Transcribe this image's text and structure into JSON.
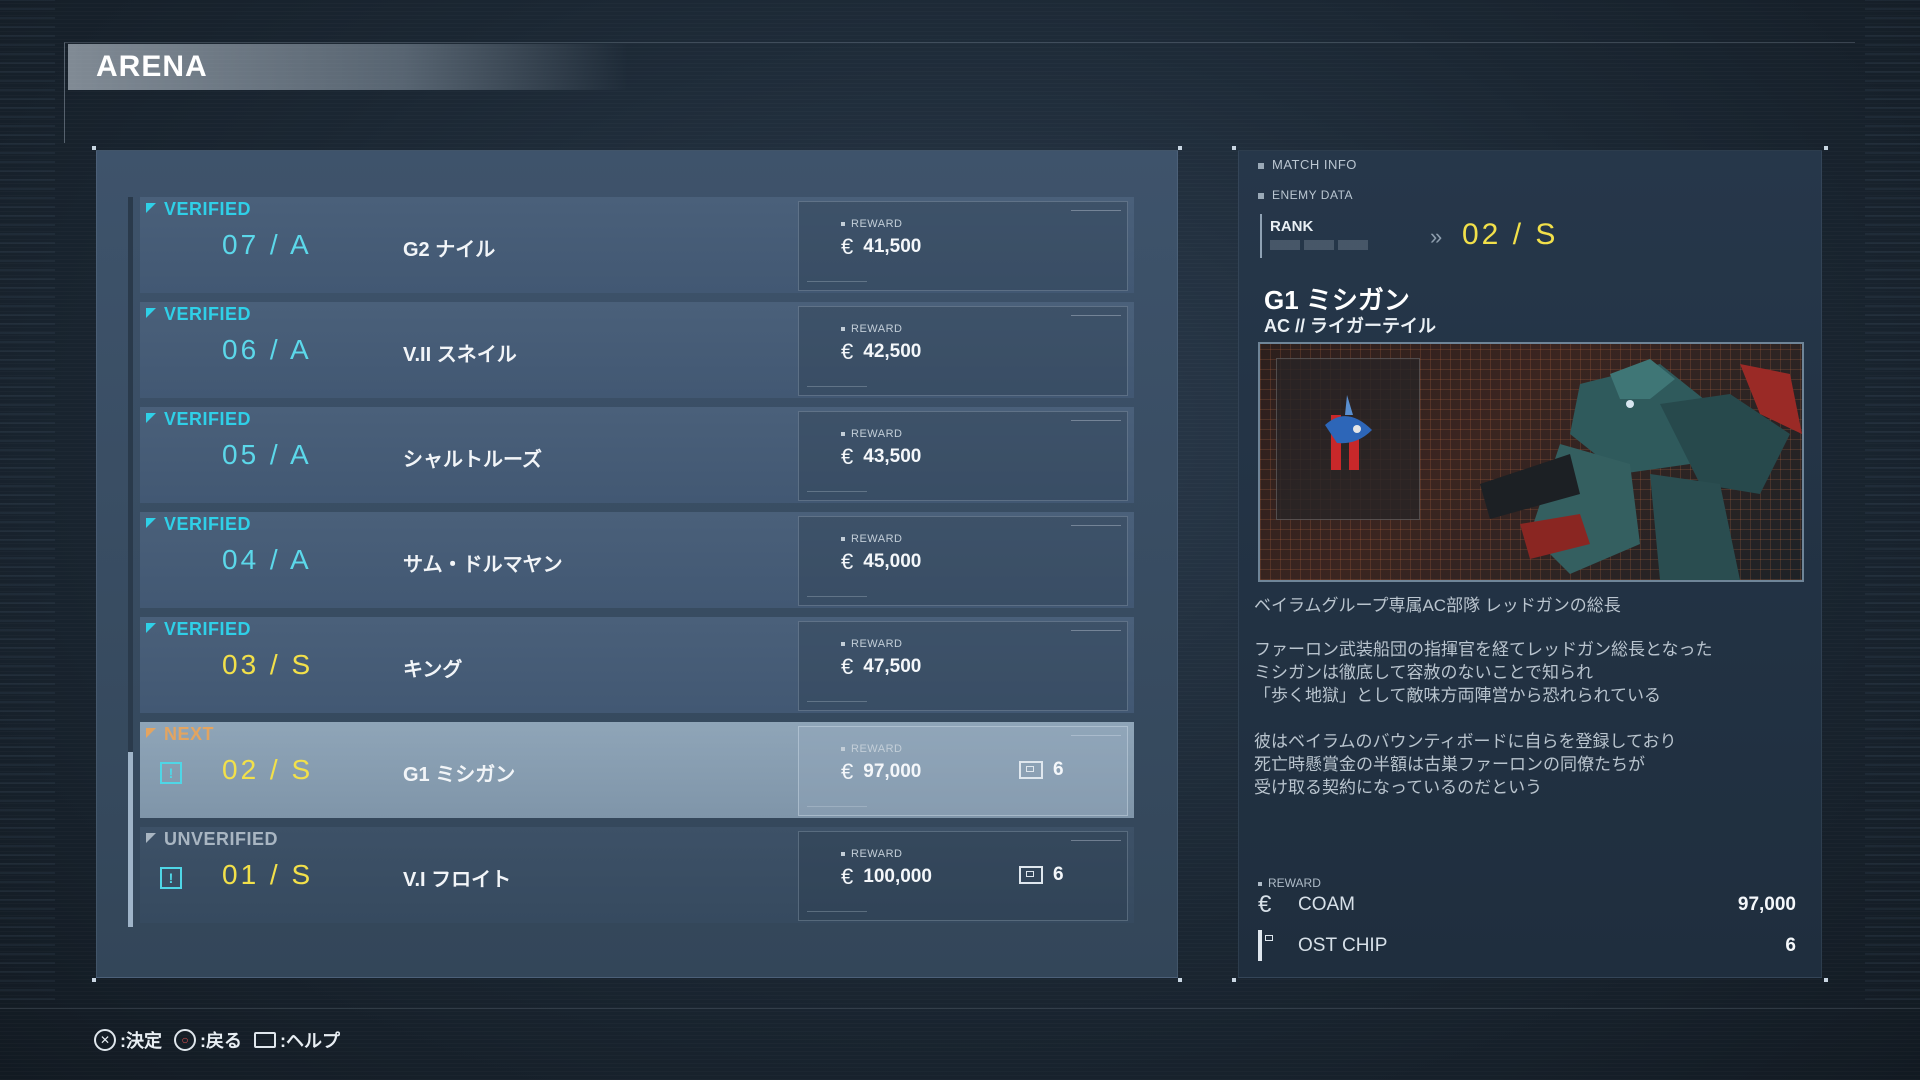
{
  "screen": {
    "title": "ARENA"
  },
  "matches": [
    {
      "status": "VERIFIED",
      "rank": "07 / A",
      "opponent": "G2 ナイル",
      "reward_label": "REWARD",
      "reward": "41,500",
      "chip": null
    },
    {
      "status": "VERIFIED",
      "rank": "06 / A",
      "opponent": "V.II スネイル",
      "reward_label": "REWARD",
      "reward": "42,500",
      "chip": null
    },
    {
      "status": "VERIFIED",
      "rank": "05 / A",
      "opponent": "シャルトルーズ",
      "reward_label": "REWARD",
      "reward": "43,500",
      "chip": null
    },
    {
      "status": "VERIFIED",
      "rank": "04 / A",
      "opponent": "サム・ドルマヤン",
      "reward_label": "REWARD",
      "reward": "45,000",
      "chip": null
    },
    {
      "status": "VERIFIED",
      "rank": "03 / S",
      "opponent": "キング",
      "reward_label": "REWARD",
      "reward": "47,500",
      "chip": null
    },
    {
      "status": "NEXT",
      "rank": "02 / S",
      "opponent": "G1 ミシガン",
      "reward_label": "REWARD",
      "reward": "97,000",
      "chip": "6"
    },
    {
      "status": "UNVERIFIED",
      "rank": "01 / S",
      "opponent": "V.I フロイト",
      "reward_label": "REWARD",
      "reward": "100,000",
      "chip": "6"
    }
  ],
  "match_info": {
    "header": "MATCH INFO",
    "enemy_data_label": "ENEMY DATA",
    "rank_label": "RANK",
    "rank_value": "02 / S",
    "enemy_name": "G1 ミシガン",
    "enemy_ac": "AC // ライガーテイル",
    "tagline": "ベイラムグループ専属AC部隊 レッドガンの総長",
    "desc1": [
      "ファーロン武装船団の指揮官を経てレッドガン総長となった",
      "ミシガンは徹底して容赦のないことで知られ",
      "「歩く地獄」として敵味方両陣営から恐れられている"
    ],
    "desc2": [
      "彼はベイラムのバウンティボードに自らを登録しており",
      "死亡時懸賞金の半額は古巣ファーロンの同僚たちが",
      "受け取る契約になっているのだという"
    ],
    "reward_header": "REWARD",
    "coam_label": "COAM",
    "coam_value": "97,000",
    "chip_label": "OST CHIP",
    "chip_value": "6"
  },
  "footer": {
    "confirm": ":決定",
    "back": ":戻る",
    "help": ":ヘルプ"
  },
  "icons": {
    "currency": "coam-icon",
    "chip": "ost-chip-icon",
    "warning": "alert-icon"
  },
  "colors": {
    "verified": "#2fd0e8",
    "next": "#e3a460",
    "unverified": "#a9b6c2",
    "rank_a": "#5cd8ea",
    "rank_s": "#f2e04a"
  }
}
